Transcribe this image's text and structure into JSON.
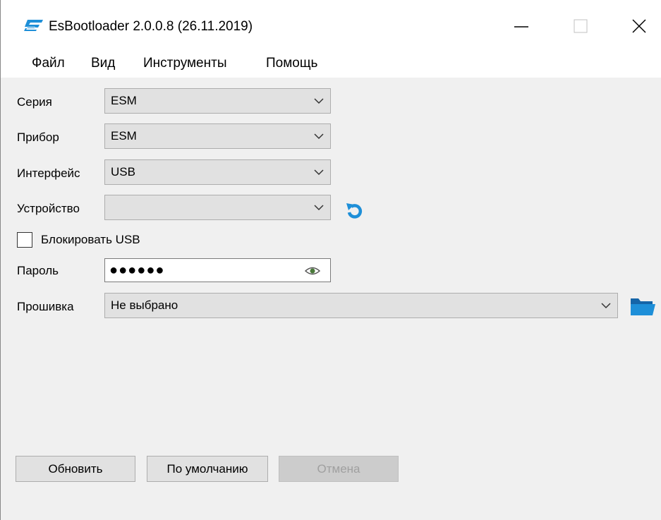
{
  "window": {
    "title": "EsBootloader 2.0.0.8 (26.11.2019)",
    "accent_color": "#1e8fd8"
  },
  "menu": {
    "items": [
      {
        "label": "Файл"
      },
      {
        "label": "Вид"
      },
      {
        "label": "Инструменты"
      },
      {
        "label": "Помощь"
      }
    ]
  },
  "form": {
    "series": {
      "label": "Серия",
      "value": "ESM"
    },
    "device": {
      "label": "Прибор",
      "value": "ESM"
    },
    "interface": {
      "label": "Интерфейс",
      "value": "USB"
    },
    "hardware": {
      "label": "Устройство",
      "value": ""
    },
    "block_usb": {
      "label": "Блокировать USB",
      "checked": false
    },
    "password": {
      "label": "Пароль",
      "masked_value": "●●●●●●"
    },
    "firmware": {
      "label": "Прошивка",
      "value": "Не выбрано"
    }
  },
  "buttons": {
    "refresh": "Обновить",
    "default": "По умолчанию",
    "cancel": "Отмена"
  },
  "icons": {
    "app": "esbootloader-logo-icon",
    "minimize": "minimize-icon",
    "maximize": "maximize-icon",
    "close": "close-icon",
    "dropdown": "chevron-down-icon",
    "refresh": "refresh-icon",
    "eye": "eye-icon",
    "folder": "folder-icon"
  }
}
